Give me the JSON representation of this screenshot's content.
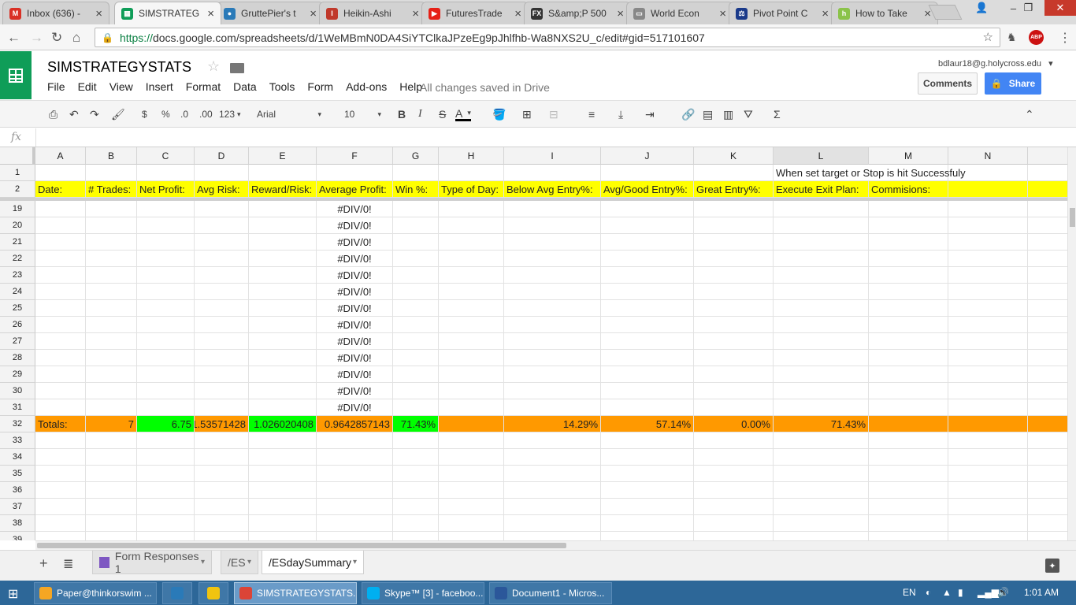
{
  "browser": {
    "tabs": [
      {
        "label": "Inbox (636) -",
        "icon": "gmail-icon",
        "color": "#d93025",
        "glyph": "M"
      },
      {
        "label": "SIMSTRATEG",
        "icon": "sheets-icon",
        "color": "#0f9d58",
        "glyph": "▦",
        "active": true
      },
      {
        "label": "GruttePier's t",
        "icon": "globe-icon",
        "color": "#2a7ab8",
        "glyph": "●"
      },
      {
        "label": "Heikin-Ashi",
        "icon": "investopedia-icon",
        "color": "#c0392b",
        "glyph": "I"
      },
      {
        "label": "FuturesTrade",
        "icon": "youtube-icon",
        "color": "#e62117",
        "glyph": "▶"
      },
      {
        "label": "S&amp;P 500",
        "icon": "finviz-icon",
        "color": "#333333",
        "glyph": "FX"
      },
      {
        "label": "World Econ",
        "icon": "page-icon",
        "color": "#888888",
        "glyph": "▭"
      },
      {
        "label": "Pivot Point C",
        "icon": "pivot-icon",
        "color": "#1a3a8a",
        "glyph": "⚖"
      },
      {
        "label": "How to Take",
        "icon": "page-h-icon",
        "color": "#8bc34a",
        "glyph": "h"
      }
    ],
    "url_scheme": "https://",
    "url_rest": "docs.google.com/spreadsheets/d/1WeMBmN0DA4SiYTClkaJPzeEg9pJhlfhb-Wa8NXS2U_c/edit#gid=517101607"
  },
  "doc": {
    "title": "SIMSTRATEGYSTATS",
    "menus": [
      "File",
      "Edit",
      "View",
      "Insert",
      "Format",
      "Data",
      "Tools",
      "Form",
      "Add-ons",
      "Help"
    ],
    "saved_status": "All changes saved in Drive",
    "account": "bdlaur18@g.holycross.edu",
    "comments_label": "Comments",
    "share_label": "Share"
  },
  "toolbar": {
    "currency": "$",
    "percent": "%",
    "dec_less": ".0",
    "dec_more": ".00",
    "more_formats": "123",
    "font": "Arial",
    "font_size": "10",
    "bold": "B",
    "italic": "I",
    "strike": "S",
    "text_color": "A"
  },
  "formula": {
    "fx": "fx",
    "value": ""
  },
  "grid": {
    "columns": [
      "A",
      "B",
      "C",
      "D",
      "E",
      "F",
      "G",
      "H",
      "I",
      "J",
      "K",
      "L",
      "M",
      "N"
    ],
    "selected_column": "L",
    "row1_note": "When set target or Stop is hit Successfuly",
    "headers": [
      "Date:",
      "# Trades:",
      "Net Profit:",
      "Avg Risk:",
      "Reward/Risk:",
      "Average Profit:",
      "Win %:",
      "Type of Day:",
      "Below Avg Entry%:",
      "Avg/Good Entry%:",
      "Great Entry%:",
      "Execute Exit Plan:",
      "Commisions:",
      ""
    ],
    "frozen_rows": [
      "1",
      "2"
    ],
    "rows": [
      "19",
      "20",
      "21",
      "22",
      "23",
      "24",
      "25",
      "26",
      "27",
      "28",
      "29",
      "30",
      "31"
    ],
    "error_value": "#DIV/0!",
    "totals_row_num": "32",
    "totals": [
      "Totals:",
      "7",
      "6.75",
      "1.53571428",
      "1.026020408",
      "0.9642857143",
      "71.43%",
      "",
      "14.29%",
      "57.14%",
      "0.00%",
      "71.43%",
      "",
      ""
    ],
    "empty_rows": [
      "33",
      "34",
      "35",
      "36",
      "37",
      "38",
      "39"
    ],
    "colors": {
      "header_yellow": "#ffff00",
      "totals_orange": "#ff9900",
      "good_green": "#00ff00"
    }
  },
  "sheets": {
    "tabs": [
      {
        "label": "Form Responses 1",
        "icon": "form-icon"
      },
      {
        "label": "/ES"
      },
      {
        "label": "/ESdaySummary",
        "active": true
      }
    ]
  },
  "taskbar": {
    "items": [
      {
        "label": "Paper@thinkorswim ...",
        "icon": "thinkorswim-icon"
      },
      {
        "label": "",
        "icon": "outlook-icon"
      },
      {
        "label": "",
        "icon": "folder-icon"
      },
      {
        "label": "SIMSTRATEGYSTATS...",
        "icon": "chrome-icon",
        "active": true
      },
      {
        "label": "Skype™ [3] - faceboo...",
        "icon": "skype-icon"
      },
      {
        "label": "Document1 - Micros...",
        "icon": "word-icon"
      }
    ],
    "lang": "EN",
    "time": "1:01 AM"
  }
}
